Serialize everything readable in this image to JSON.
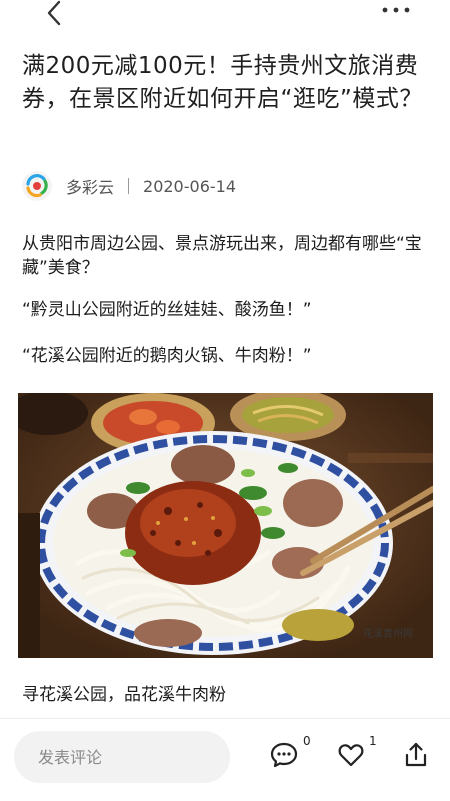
{
  "article": {
    "title": "满200元减100元！手持贵州文旅消费券，在景区附近如何开启“逛吃”模式？",
    "author": "多彩云",
    "date": "2020-06-14",
    "paragraphs": [
      "从贵阳市周边公园、景点游玩出来，周边都有哪些“宝藏”美食？",
      "“黔灵山公园附近的丝娃娃、酸汤鱼！”",
      "“花溪公园附近的鹅肉火锅、牛肉粉！”"
    ],
    "image_watermark": "花溪贵州网",
    "caption": "寻花溪公园，品花溪牛肉粉"
  },
  "bottom_bar": {
    "comment_placeholder": "发表评论",
    "comment_count": "0",
    "like_count": "1"
  },
  "icons": {
    "back": "back-arrow-icon",
    "more": "more-dots-icon",
    "comment": "comment-bubble-icon",
    "like": "heart-icon",
    "share": "share-icon"
  }
}
